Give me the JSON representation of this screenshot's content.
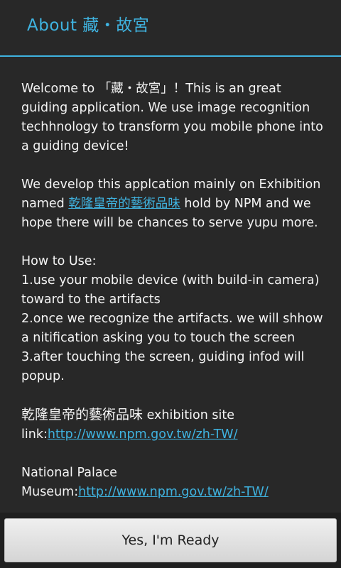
{
  "header": {
    "title": "About 藏・故宮"
  },
  "content": {
    "intro": "Welcome to 「藏・故宮」！This is an great guiding application. We use image recognition techhnology to transform you mobile phone into a guiding device!",
    "develop_prefix": "We develop this applcation mainly on Exhibition named ",
    "exhibition_link": "乾隆皇帝的藝術品味",
    "develop_suffix": " hold by NPM and we hope there will be chances to serve yupu more.",
    "howto_title": "How to Use:",
    "step1": "1.use your mobile device (with build-in camera) toward to the artifacts",
    "step2": "2.once we recognize the artifacts. we will shhow a nitification asking you to touch the screen",
    "step3": "3.after touching the screen, guiding infod will popup.",
    "site_prefix_chinese": "乾隆皇帝的藝術品味",
    "site_prefix_label": " exhibition site link:",
    "site_link": "http://www.npm.gov.tw/zh-TW/",
    "museum_label": "National Palace Museum:",
    "museum_link": "http://www.npm.gov.tw/zh-TW/"
  },
  "footer": {
    "ready_button": "Yes, I'm Ready"
  },
  "colors": {
    "accent": "#3fb3e0",
    "background": "#282828"
  }
}
